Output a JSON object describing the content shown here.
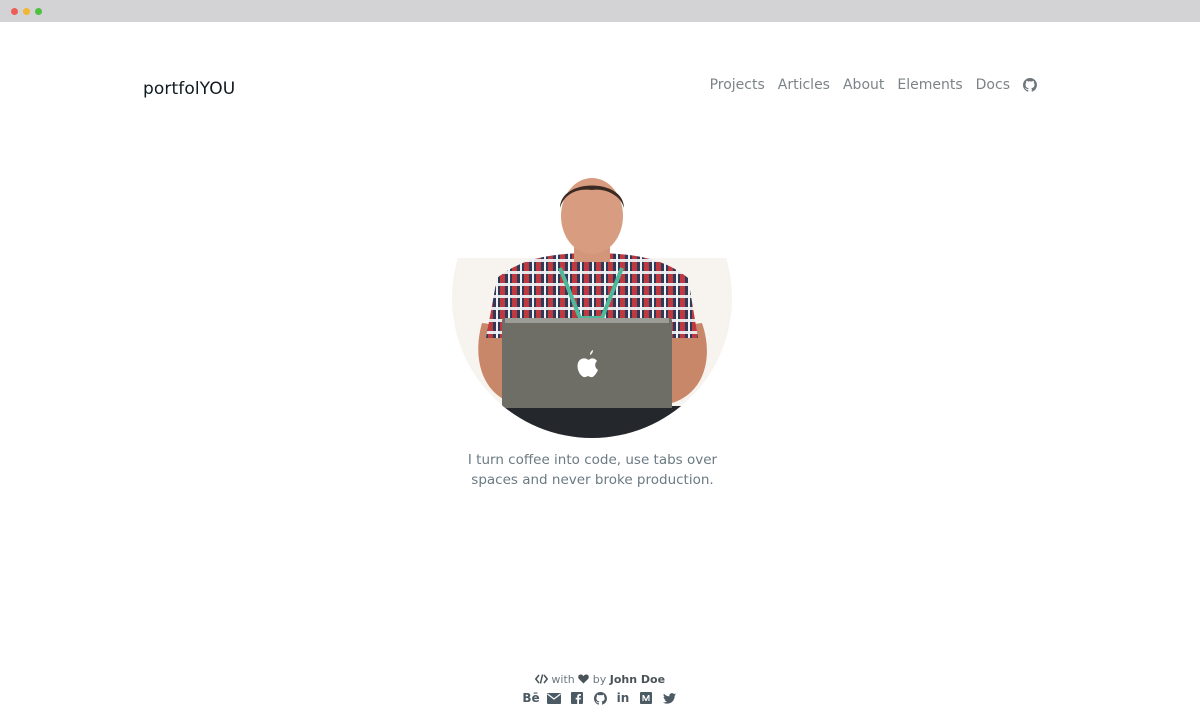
{
  "brand": "portfolYOU",
  "nav": {
    "items": [
      "Projects",
      "Articles",
      "About",
      "Elements",
      "Docs"
    ],
    "github_icon": "github-icon"
  },
  "hero": {
    "bio": "I turn coffee into code, use tabs over spaces and never broke production."
  },
  "footer": {
    "with": "with",
    "by": "by",
    "author": "John Doe",
    "socials": [
      "behance",
      "email",
      "facebook",
      "github",
      "linkedin",
      "medium",
      "twitter"
    ],
    "behance_label": "Bē",
    "linkedin_label": "in"
  },
  "colors": {
    "accent": "#0f1a20",
    "text": "#6b7a83",
    "nav": "#7c8387"
  }
}
